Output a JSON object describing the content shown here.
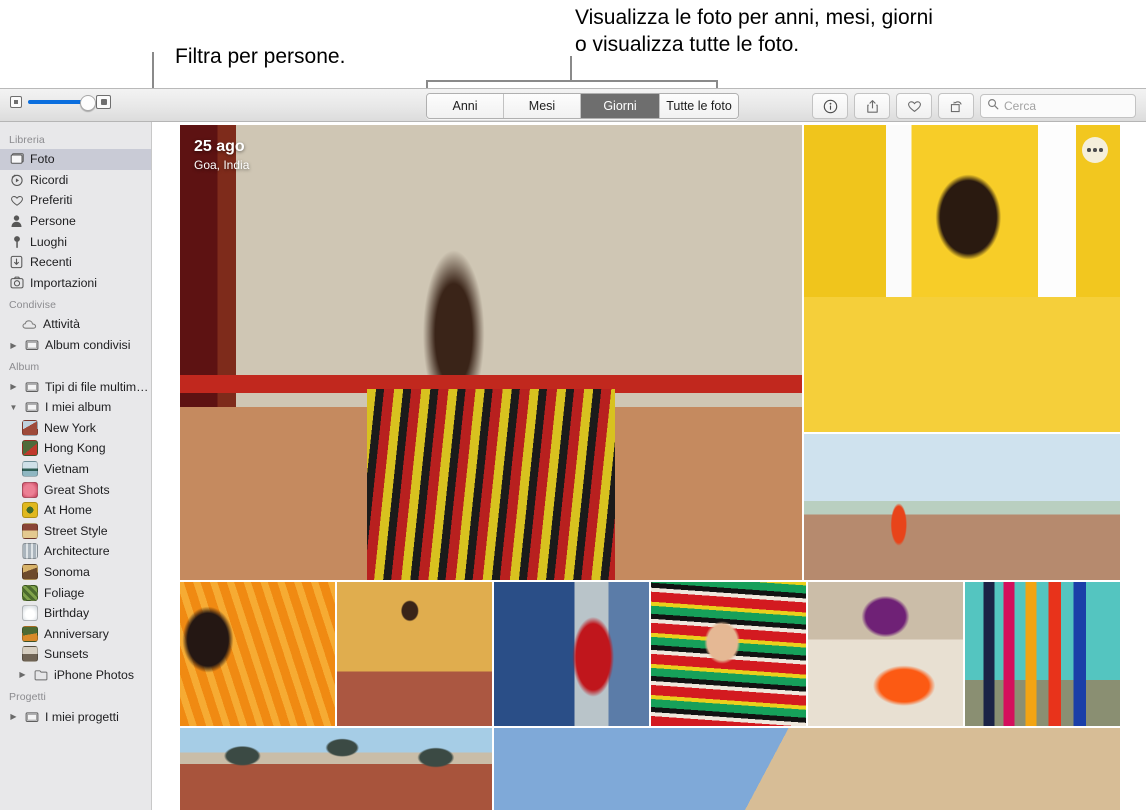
{
  "callouts": {
    "left": "Filtra per persone.",
    "right_line1": "Visualizza le foto per anni, mesi, giorni",
    "right_line2": "o visualizza tutte le foto."
  },
  "toolbar": {
    "zoom_slider": {
      "small_icon": "grid-small-icon",
      "large_icon": "grid-large-icon",
      "value": 100
    },
    "segments": [
      {
        "id": "anni",
        "label": "Anni",
        "selected": false
      },
      {
        "id": "mesi",
        "label": "Mesi",
        "selected": false
      },
      {
        "id": "giorni",
        "label": "Giorni",
        "selected": true
      },
      {
        "id": "tutte",
        "label": "Tutte le foto",
        "selected": false
      }
    ],
    "buttons": [
      {
        "id": "info",
        "icon": "info-icon"
      },
      {
        "id": "share",
        "icon": "share-icon"
      },
      {
        "id": "favorite",
        "icon": "heart-icon"
      },
      {
        "id": "rotate",
        "icon": "rotate-icon"
      }
    ],
    "search": {
      "icon": "search-icon",
      "placeholder": "Cerca",
      "value": ""
    }
  },
  "sidebar": {
    "sections": [
      {
        "title": "Libreria",
        "items": [
          {
            "label": "Foto",
            "icon": "photos-icon",
            "selected": true,
            "disclosure": false
          },
          {
            "label": "Ricordi",
            "icon": "memories-icon",
            "selected": false,
            "disclosure": false
          },
          {
            "label": "Preferiti",
            "icon": "heart-icon",
            "selected": false,
            "disclosure": false
          },
          {
            "label": "Persone",
            "icon": "person-icon",
            "selected": false,
            "disclosure": false
          },
          {
            "label": "Luoghi",
            "icon": "pin-icon",
            "selected": false,
            "disclosure": false
          },
          {
            "label": "Recenti",
            "icon": "download-icon",
            "selected": false,
            "disclosure": false
          },
          {
            "label": "Importazioni",
            "icon": "import-icon",
            "selected": false,
            "disclosure": false
          }
        ]
      },
      {
        "title": "Condivise",
        "items": [
          {
            "label": "Attività",
            "icon": "cloud-icon",
            "selected": false,
            "disclosure": false,
            "indent": true
          },
          {
            "label": "Album condivisi",
            "icon": "folder-icon",
            "selected": false,
            "disclosure": true
          }
        ]
      },
      {
        "title": "Album",
        "items": [
          {
            "label": "Tipi di file multimediali",
            "icon": "folder-icon",
            "selected": false,
            "disclosure": true
          },
          {
            "label": "I miei album",
            "icon": "folder-icon",
            "selected": false,
            "disclosure": true,
            "expanded": true
          }
        ]
      }
    ],
    "albums": [
      {
        "label": "New York",
        "thumb": "#9f4a3a"
      },
      {
        "label": "Hong Kong",
        "thumb": "#4e6b3a"
      },
      {
        "label": "Vietnam",
        "thumb": "#7aa6bd"
      },
      {
        "label": "Great Shots",
        "thumb": "#d9627a"
      },
      {
        "label": "At Home",
        "thumb": "#c8a020"
      },
      {
        "label": "Street Style",
        "thumb": "#8a4436"
      },
      {
        "label": "Architecture",
        "thumb": "#8f9aa3"
      },
      {
        "label": "Sonoma",
        "thumb": "#6d4a2c"
      },
      {
        "label": "Foliage",
        "thumb": "#5d7a3c"
      },
      {
        "label": "Birthday",
        "thumb": "#cfd6dc"
      },
      {
        "label": "Anniversary",
        "thumb": "#4d6a33"
      },
      {
        "label": "Sunsets",
        "thumb": "#b7b0a4"
      }
    ],
    "iphone_photos": {
      "label": "iPhone Photos",
      "icon": "folder-icon",
      "disclosure": true
    },
    "projects_section": {
      "title": "Progetti",
      "items": [
        {
          "label": "I miei progetti",
          "icon": "folder-icon",
          "disclosure": true
        }
      ]
    }
  },
  "photo_overlay": {
    "date": "25 ago",
    "location": "Goa, India",
    "more_button": "more-options-icon"
  },
  "photos": [
    {
      "id": "hero",
      "alt": "Donna con abito a righe contro muro scrostato"
    },
    {
      "id": "man",
      "alt": "Uomo con kurta gialla"
    },
    {
      "id": "tajwalk",
      "alt": "Donna in sari rosso che cammina"
    },
    {
      "id": "orange-sari",
      "alt": "Donna con sari arancione"
    },
    {
      "id": "twirl",
      "alt": "Donna che fa volteggiare un tessuto"
    },
    {
      "id": "blue-wall",
      "alt": "Donna con sari rosso contro muro blu"
    },
    {
      "id": "hand",
      "alt": "Mano che tiene un tessuto a righe"
    },
    {
      "id": "feet",
      "alt": "Piedi su polvere arancione"
    },
    {
      "id": "laundry",
      "alt": "Bucato steso su muro turchese"
    },
    {
      "id": "monument",
      "alt": "Monumento con cupole"
    },
    {
      "id": "sky",
      "alt": "Cielo azzurro sopra una duna"
    }
  ],
  "colors": {
    "accent": "#0a6ede",
    "sidebar_bg": "#e8e8ea",
    "sidebar_selection": "#c9cbd6",
    "segment_selected": "#6e6e6e",
    "callout_line": "#8a8a8a"
  }
}
